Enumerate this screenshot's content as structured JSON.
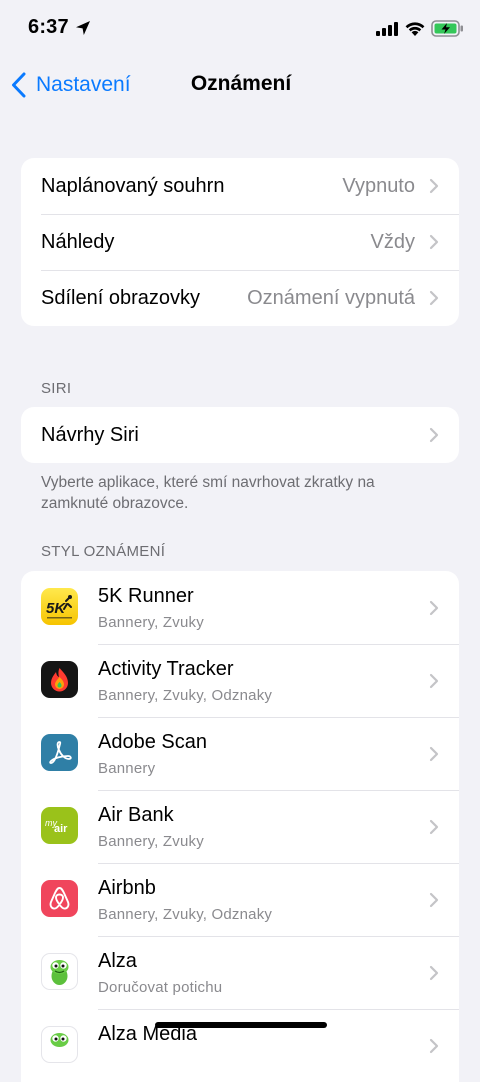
{
  "status_bar": {
    "time": "6:37",
    "icons": [
      "location-arrow-icon",
      "signal-icon",
      "wifi-icon",
      "battery-charging-icon"
    ]
  },
  "nav": {
    "back_label": "Nastavení",
    "title": "Oznámení",
    "accent_color": "#0a7aff"
  },
  "general": {
    "rows": [
      {
        "label": "Naplánovaný souhrn",
        "value": "Vypnuto"
      },
      {
        "label": "Náhledy",
        "value": "Vždy"
      },
      {
        "label": "Sdílení obrazovky",
        "value": "Oznámení vypnutá"
      }
    ]
  },
  "siri": {
    "header": "SIRI",
    "row_label": "Návrhy Siri",
    "footer": "Vyberte aplikace, které smí navrhovat zkratky na zamknuté obrazovce."
  },
  "styles": {
    "header": "STYL OZNÁMENÍ",
    "apps": [
      {
        "name": "5K Runner",
        "detail": "Bannery, Zvuky",
        "icon": "5k-runner-icon",
        "icon_text": "5K"
      },
      {
        "name": "Activity Tracker",
        "detail": "Bannery, Zvuky, Odznaky",
        "icon": "activity-tracker-icon"
      },
      {
        "name": "Adobe Scan",
        "detail": "Bannery",
        "icon": "adobe-scan-icon"
      },
      {
        "name": "Air Bank",
        "detail": "Bannery, Zvuky",
        "icon": "air-bank-icon",
        "icon_text_small": "my",
        "icon_text": "air"
      },
      {
        "name": "Airbnb",
        "detail": "Bannery, Zvuky, Odznaky",
        "icon": "airbnb-icon"
      },
      {
        "name": "Alza",
        "detail": "Doručovat potichu",
        "icon": "alza-icon"
      },
      {
        "name": "Alza Media",
        "detail": "",
        "icon": "alza-media-icon"
      }
    ]
  }
}
